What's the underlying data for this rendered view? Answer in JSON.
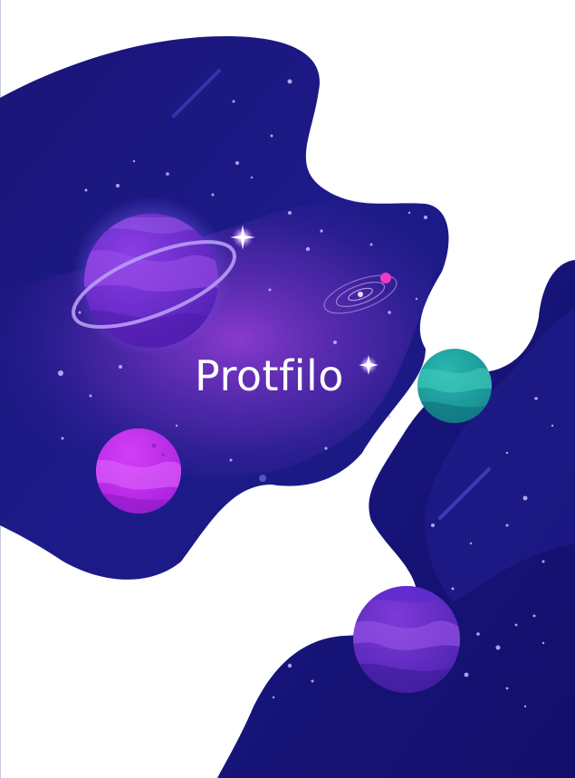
{
  "title": "Protfilo",
  "colors": {
    "background": "#ffffff",
    "space_deep": "#13106a",
    "space_mid": "#1e1b8c",
    "nebula": "#7b2cc4",
    "saturn": "#7a2fd6",
    "magenta_planet": "#c52cf0",
    "teal_planet": "#1aa5a0",
    "violet_planet": "#6a2fc8"
  },
  "icons": [
    "saturn-planet-icon",
    "magenta-planet-icon",
    "teal-planet-icon",
    "violet-planet-icon",
    "galaxy-orbit-icon",
    "comet-icon",
    "sparkle-star-icon"
  ]
}
